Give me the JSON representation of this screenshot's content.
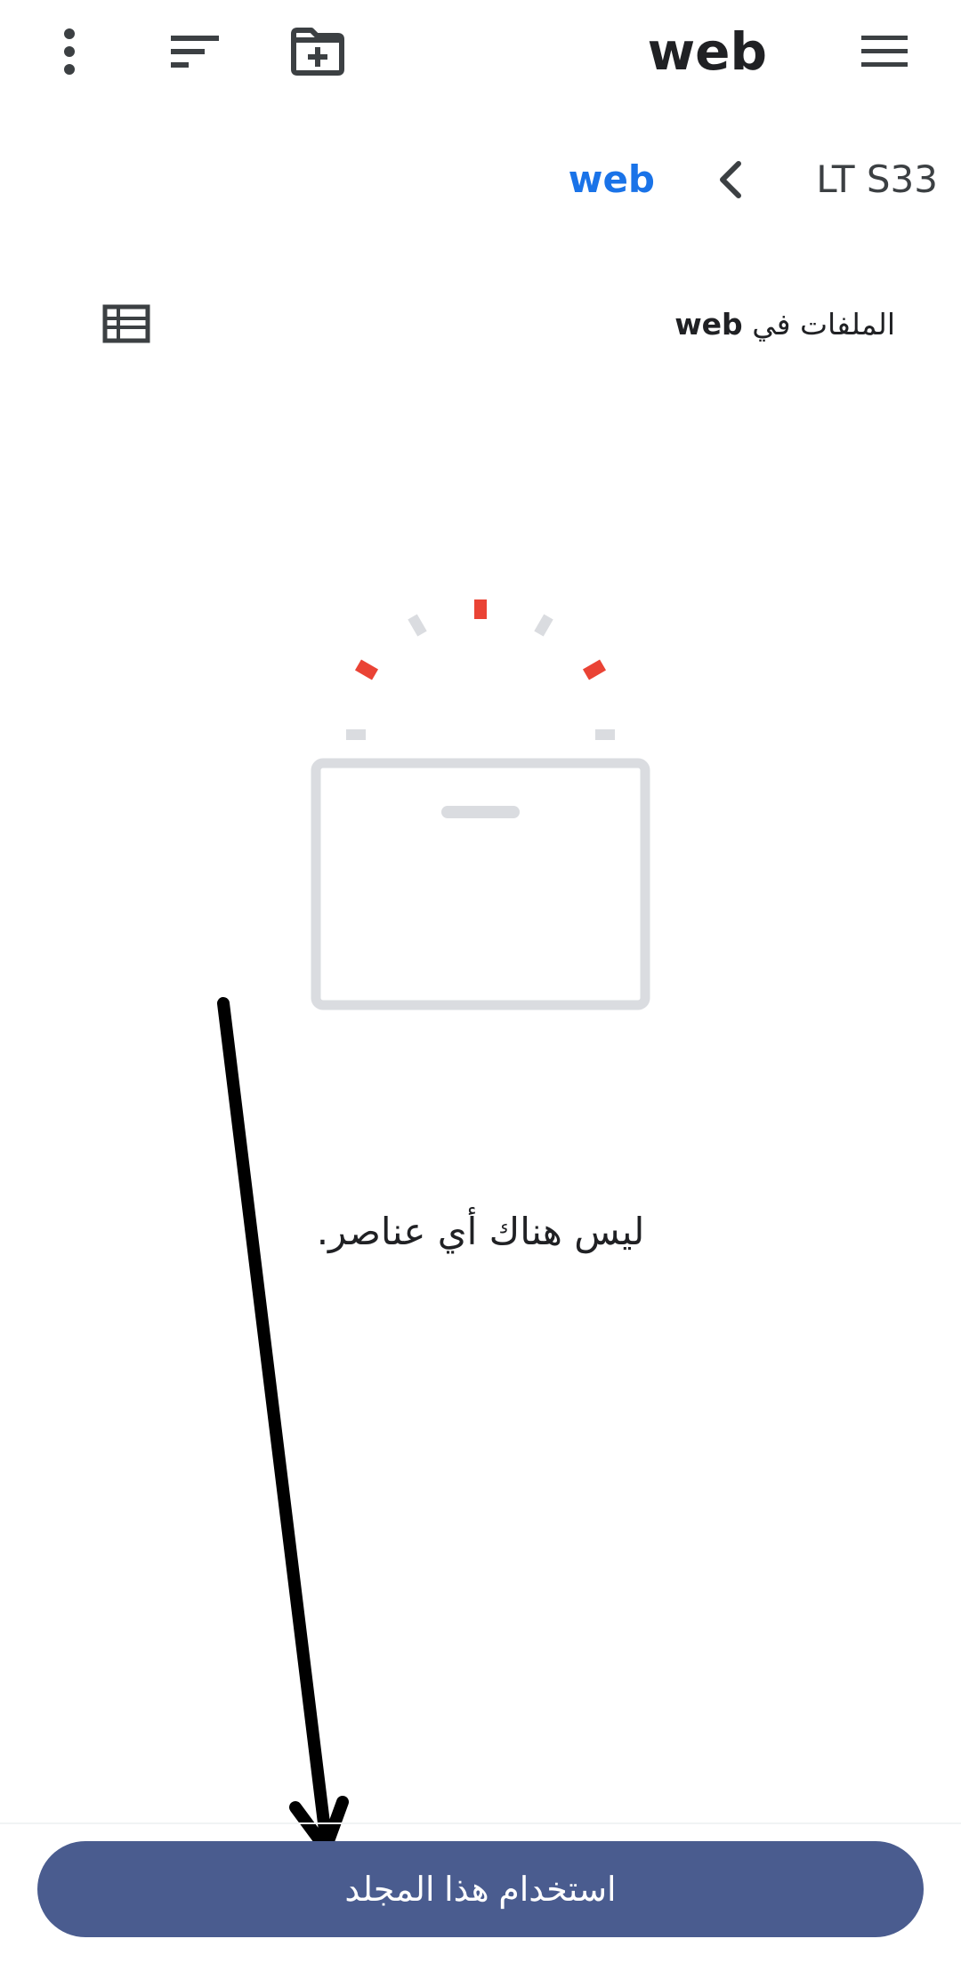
{
  "app_bar": {
    "title": "web",
    "icons": [
      "menu-icon",
      "new-folder-icon",
      "sort-icon",
      "more-vert-icon"
    ]
  },
  "breadcrumb": {
    "root": "LT S33",
    "current": "web"
  },
  "section": {
    "label_prefix": "الملفات في",
    "folder_name": "web",
    "view_toggle_icon": "list-view-icon"
  },
  "empty_state": {
    "message": "ليس هناك أي عناصر."
  },
  "bottom": {
    "use_folder_label": "استخدام هذا المجلد"
  },
  "colors": {
    "accent_link": "#1a73e8",
    "button": "#4a5c8f",
    "illustration_gray": "#dadce0",
    "illustration_red": "#ea4335",
    "annotation_arrow": "#000000"
  }
}
